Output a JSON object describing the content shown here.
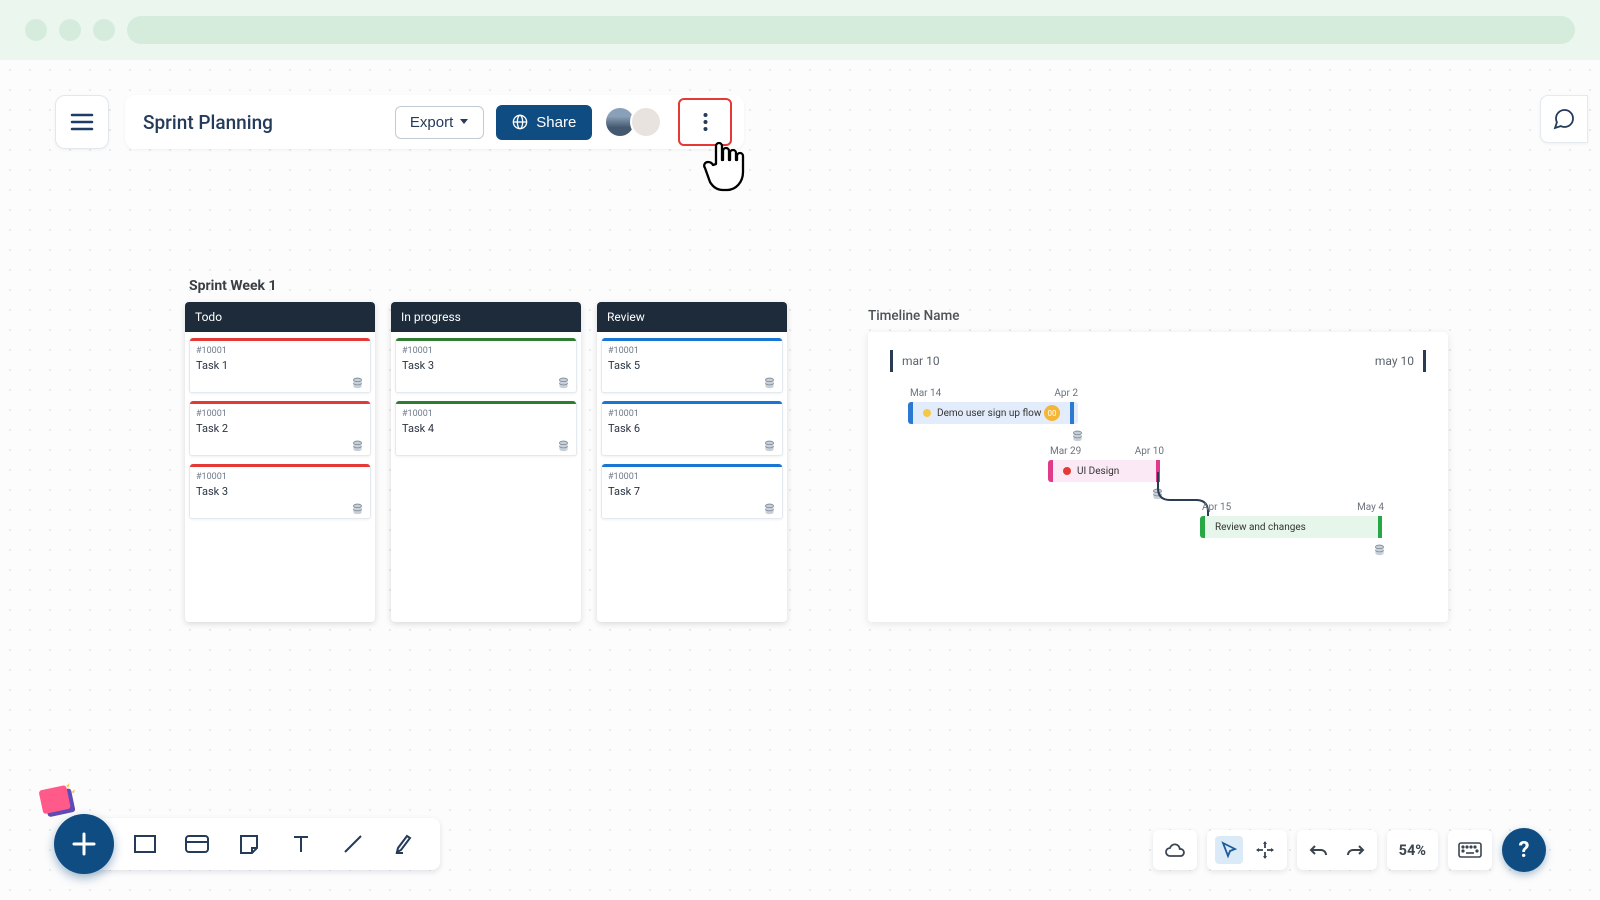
{
  "header": {
    "title": "Sprint Planning",
    "export": "Export",
    "share": "Share"
  },
  "board": {
    "title": "Sprint Week 1",
    "columns": [
      {
        "name": "Todo",
        "color": "red",
        "cards": [
          {
            "id": "#10001",
            "title": "Task 1"
          },
          {
            "id": "#10001",
            "title": "Task 2"
          },
          {
            "id": "#10001",
            "title": "Task 3"
          }
        ]
      },
      {
        "name": "In progress",
        "color": "green",
        "cards": [
          {
            "id": "#10001",
            "title": "Task 3"
          },
          {
            "id": "#10001",
            "title": "Task 4"
          }
        ]
      },
      {
        "name": "Review",
        "color": "blue",
        "cards": [
          {
            "id": "#10001",
            "title": "Task 5"
          },
          {
            "id": "#10001",
            "title": "Task 6"
          },
          {
            "id": "#10001",
            "title": "Task 7"
          }
        ]
      }
    ]
  },
  "timeline": {
    "title": "Timeline Name",
    "range_start": "mar 10",
    "range_end": "may 10",
    "items": [
      {
        "start": "Mar 14",
        "end": "Apr 2",
        "label": "Demo user sign up flow"
      },
      {
        "start": "Mar 29",
        "end": "Apr 10",
        "label": "UI Design"
      },
      {
        "start": "Apr 15",
        "end": "May 4",
        "label": "Review and changes"
      }
    ]
  },
  "bottombar": {
    "zoom": "54%"
  },
  "help": "?"
}
